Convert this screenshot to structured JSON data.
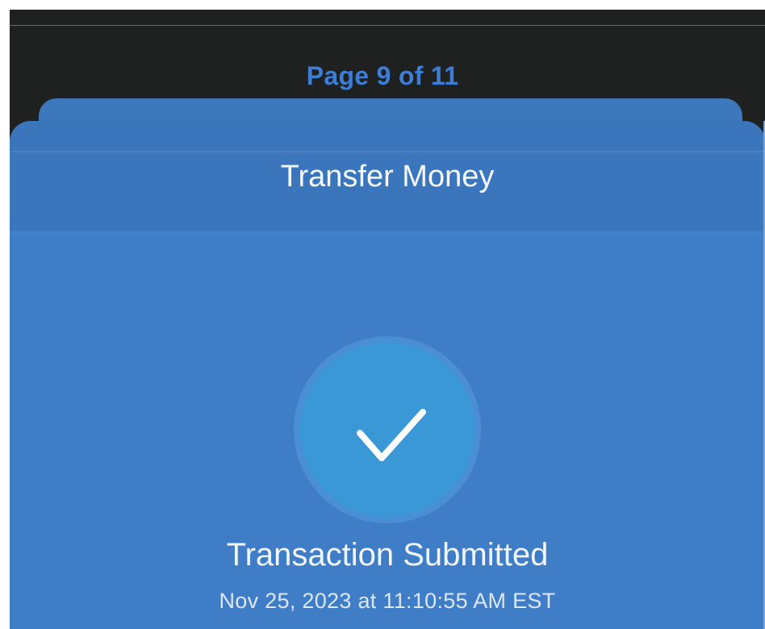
{
  "document": {
    "page_label": "Page 9 of 11"
  },
  "screen": {
    "header_title": "Transfer Money",
    "status_title": "Transaction Submitted",
    "status_timestamp": "Nov 25, 2023 at 11:10:55 AM EST",
    "status_icon": "checkmark-icon"
  },
  "colors": {
    "sheet_blue": "#3f7dc6",
    "check_circle": "#3a98d6",
    "page_label": "#3c7ed6",
    "dark_header": "#1f2020"
  }
}
